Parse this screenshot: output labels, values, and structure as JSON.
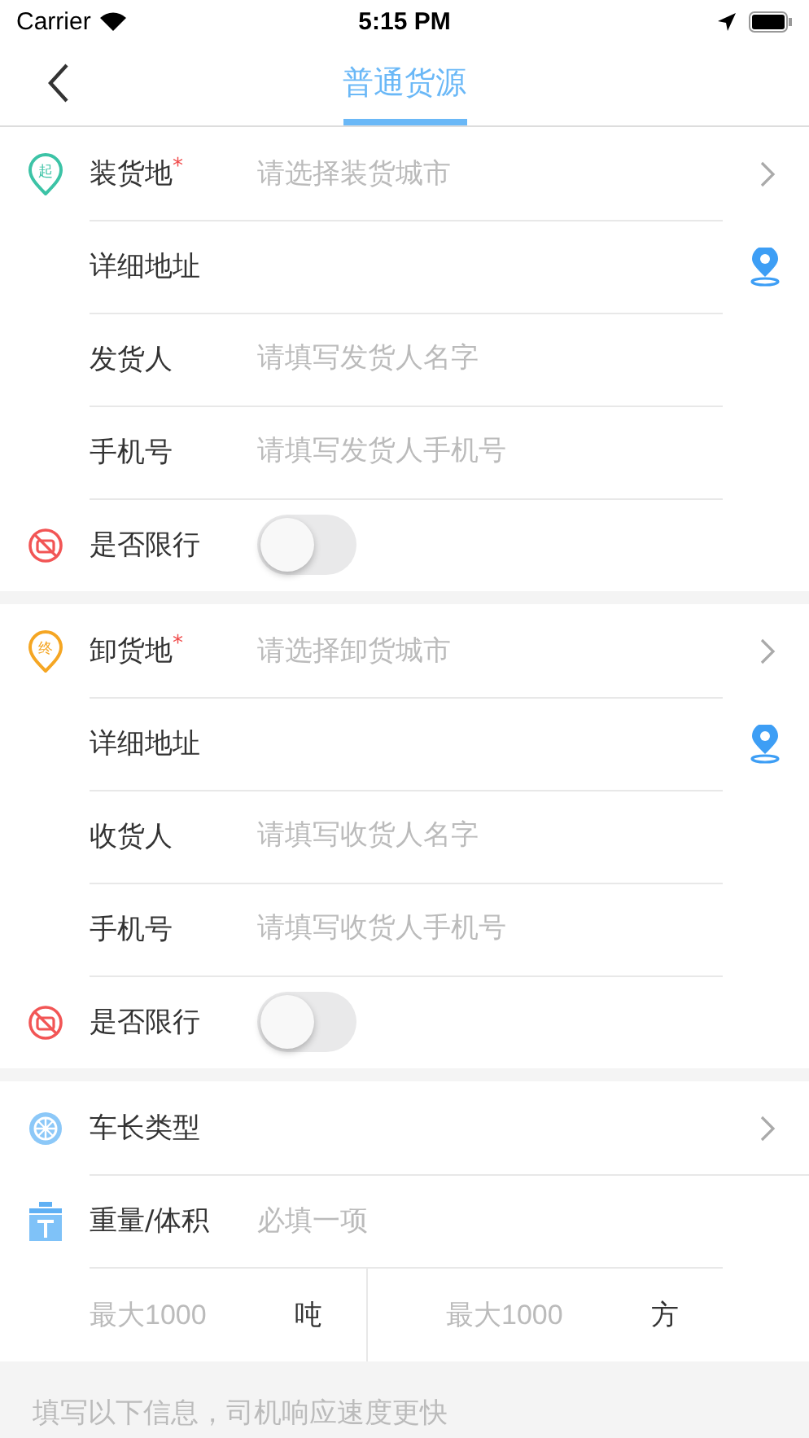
{
  "status_bar": {
    "carrier": "Carrier",
    "time": "5:15 PM"
  },
  "nav": {
    "title": "普通货源"
  },
  "sections": [
    {
      "rows": [
        {
          "kind": "select",
          "label": "装货地",
          "mark": "*",
          "placeholder": "请选择装货城市",
          "pin": {
            "text": "起",
            "color": "#3cc3a6"
          }
        },
        {
          "kind": "address",
          "label": "详细地址"
        },
        {
          "kind": "input",
          "label": "发货人",
          "placeholder": "请填写发货人名字"
        },
        {
          "kind": "input",
          "label": "手机号",
          "placeholder": "请填写发货人手机号"
        },
        {
          "kind": "toggle",
          "label": "是否限行",
          "on": false
        }
      ]
    },
    {
      "rows": [
        {
          "kind": "select",
          "label": "卸货地",
          "mark": "*",
          "placeholder": "请选择卸货城市",
          "pin": {
            "text": "终",
            "color": "#f5a623"
          }
        },
        {
          "kind": "address",
          "label": "详细地址"
        },
        {
          "kind": "input",
          "label": "收货人",
          "placeholder": "请填写收货人名字"
        },
        {
          "kind": "input",
          "label": "手机号",
          "placeholder": "请填写收货人手机号"
        },
        {
          "kind": "toggle",
          "label": "是否限行",
          "on": false
        }
      ]
    },
    {
      "rows": [
        {
          "kind": "length",
          "label": "车长类型"
        },
        {
          "kind": "weight",
          "label": "重量/体积",
          "hint": "必填一项",
          "fields": [
            {
              "placeholder": "最大1000",
              "unit": "吨"
            },
            {
              "placeholder": "最大1000",
              "unit": "方"
            }
          ]
        }
      ]
    }
  ],
  "footer": {
    "text": "填写以下信息，司机响应速度更快"
  }
}
